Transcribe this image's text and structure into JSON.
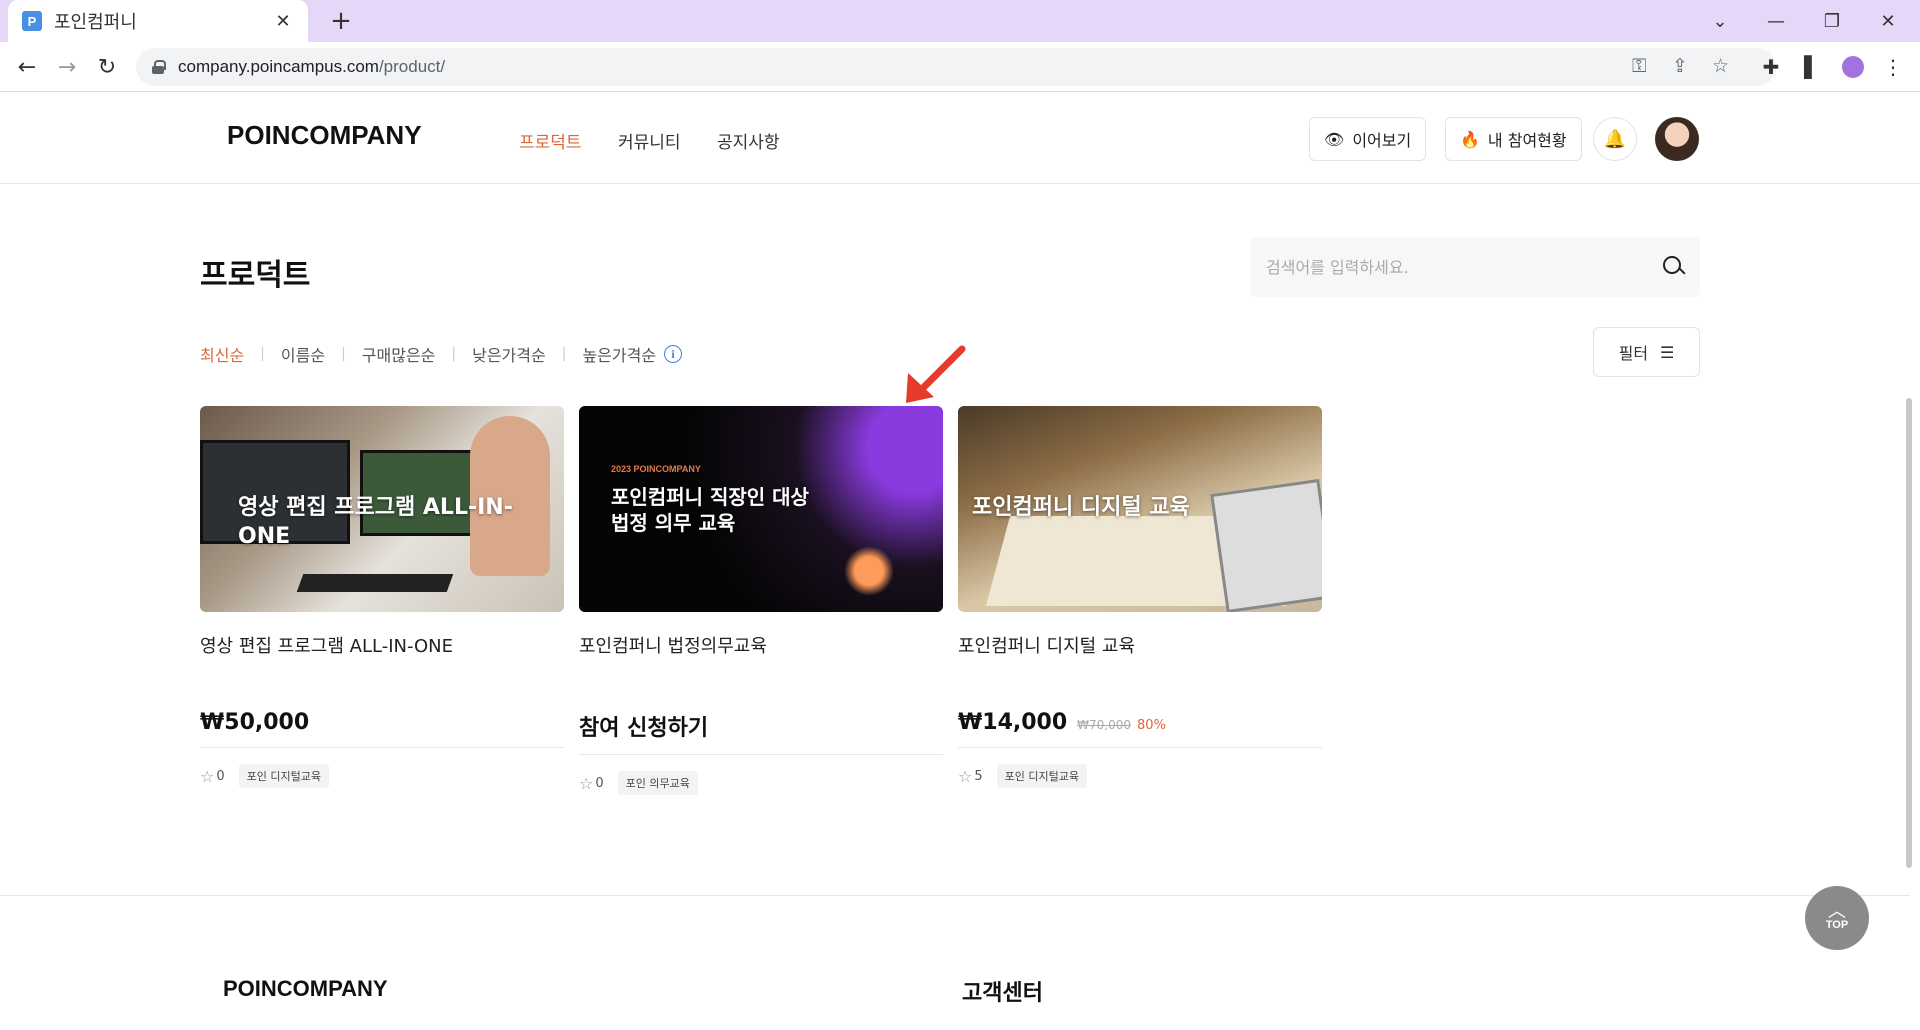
{
  "browser": {
    "tab_title": "포인컴퍼니",
    "favicon_letter": "P",
    "url_host": "company.poincampus.com",
    "url_path": "/product/"
  },
  "header": {
    "logo": "POINCOMPANY",
    "nav": [
      "프로덕트",
      "커뮤니티",
      "공지사항"
    ],
    "continue_label": "이어보기",
    "participation_label": "내 참여현황"
  },
  "page": {
    "title": "프로덕트",
    "search_placeholder": "검색어를 입력하세요.",
    "sorts": [
      "최신순",
      "이름순",
      "구매많은순",
      "낮은가격순",
      "높은가격순"
    ],
    "filter_label": "필터"
  },
  "products": [
    {
      "thumb_text": "영상 편집 프로그램 ALL-IN-ONE",
      "title": "영상 편집 프로그램 ALL-IN-ONE",
      "price": "₩50,000",
      "rating": "0",
      "tag": "포인 디지털교육"
    },
    {
      "thumb_small": "2023 POINCOMPANY",
      "thumb_text_1": "포인컴퍼니 직장인 대상",
      "thumb_text_2": "법정 의무 교육",
      "title": "포인컴퍼니 법정의무교육",
      "price": "참여 신청하기",
      "rating": "0",
      "tag": "포인 의무교육"
    },
    {
      "thumb_text": "포인컴퍼니 디지털 교육",
      "title": "포인컴퍼니 디지털 교육",
      "price": "₩14,000",
      "old_price": "₩70,000",
      "discount": "80%",
      "rating": "5",
      "tag": "포인 디지털교육"
    }
  ],
  "footer": {
    "logo": "POINCOMPANY",
    "customer_center": "고객센터"
  },
  "top_button": "TOP",
  "colors": {
    "accent": "#e0663a",
    "tabbar": "#e5d7f8"
  }
}
